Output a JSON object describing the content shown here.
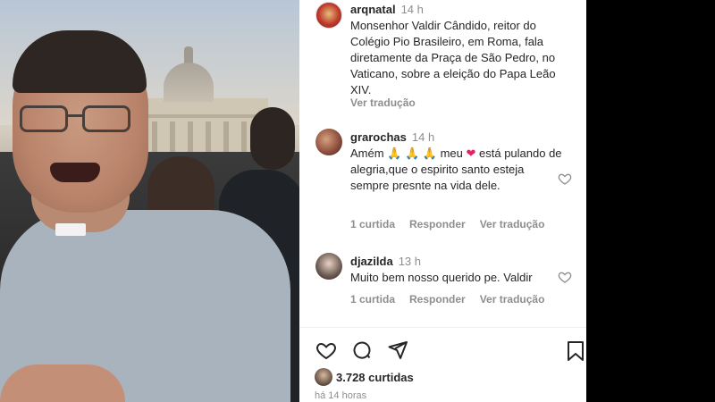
{
  "post": {
    "author": "arqnatal",
    "time": "14 h",
    "caption": "Monsenhor Valdir Cândido, reitor do Colégio Pio Brasileiro, em Roma, fala diretamente da Praça de São Pedro, no Vaticano, sobre a eleição do Papa Leão XIV.",
    "see_translation": "Ver tradução"
  },
  "comments": [
    {
      "author": "grarochas",
      "time": "14 h",
      "text_parts": [
        "Amém ",
        "🙏",
        " ",
        "🙏",
        " ",
        "🙏",
        " meu ",
        "❤",
        " está pulando de alegria,que o espirito santo esteja sempre presnte na vida dele."
      ],
      "likes": "1 curtida",
      "reply": "Responder",
      "see_translation": "Ver tradução"
    },
    {
      "author": "djazilda",
      "time": "13 h",
      "text": "Muito bem nosso querido pe. Valdir",
      "likes": "1 curtida",
      "reply": "Responder",
      "see_translation": "Ver tradução"
    }
  ],
  "footer": {
    "likes_count": "3.728 curtidas",
    "posted_ago": "há 14 horas"
  },
  "icons": {
    "like": "heart-icon",
    "comment": "comment-icon",
    "share": "share-icon",
    "save": "bookmark-icon"
  },
  "colors": {
    "text": "#262626",
    "muted": "#8e8e8e",
    "heart_emoji": "#e0245e"
  }
}
